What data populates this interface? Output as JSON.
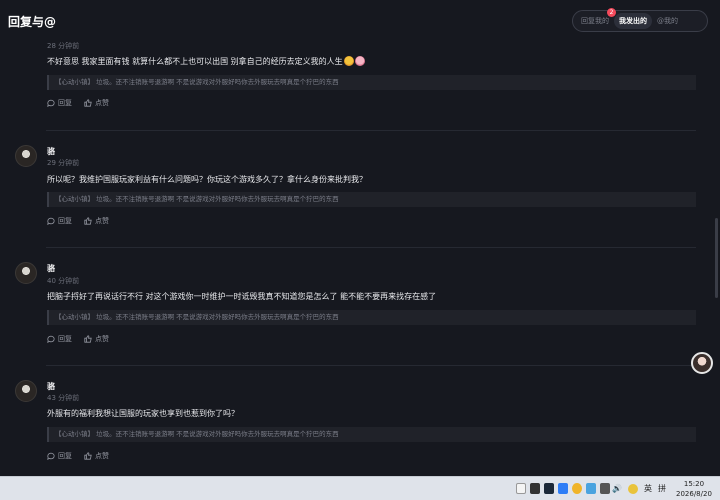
{
  "header": {
    "title": "回复与@",
    "tabs": [
      {
        "label": "回复我的",
        "badge": "2",
        "active": false
      },
      {
        "label": "我发出的",
        "active": true
      },
      {
        "label": "@我的",
        "active": false
      }
    ]
  },
  "comments": [
    {
      "user": "",
      "time": "28 分钟前",
      "content": "不好意思 我家里面有钱 就算什么都不上也可以出国 别拿自己的经历去定义我的人生",
      "quote": "【心动小镇】 垃圾。还不注销账号退游啊 不是说游戏对外服好吗你去外服玩去啊真是个狞巴的东西",
      "reply": "回复",
      "like": "点赞"
    },
    {
      "user": "骆",
      "time": "29 分钟前",
      "content": "所以呢？我维护国服玩家利益有什么问题吗？你玩这个游戏多久了？拿什么身份来批判我？",
      "quote": "【心动小镇】 垃圾。还不注销账号退游啊 不是说游戏对外服好吗你去外服玩去啊真是个狞巴的东西",
      "reply": "回复",
      "like": "点赞"
    },
    {
      "user": "骆",
      "time": "40 分钟前",
      "content": "把脑子捋好了再说话行不行 对这个游戏你一时维护一时诋毁我真不知道您是怎么了 能不能不要再来找存在感了",
      "quote": "【心动小镇】 垃圾。还不注销账号退游啊 不是说游戏对外服好吗你去外服玩去啊真是个狞巴的东西",
      "reply": "回复",
      "like": "点赞"
    },
    {
      "user": "骆",
      "time": "43 分钟前",
      "content": "外服有的福利我想让国服的玩家也享到也惹到你了吗？",
      "quote": "【心动小镇】 垃圾。还不注销账号退游啊 不是说游戏对外服好吗你去外服玩去啊真是个狞巴的东西",
      "reply": "回复",
      "like": "点赞"
    }
  ],
  "taskbar": {
    "ime": "英",
    "layout": "拼",
    "time": "15:20",
    "date": "2026/8/20"
  },
  "colors": {
    "background": "#16181f",
    "badge": "#f4495b",
    "text": "#e8e9ec"
  }
}
